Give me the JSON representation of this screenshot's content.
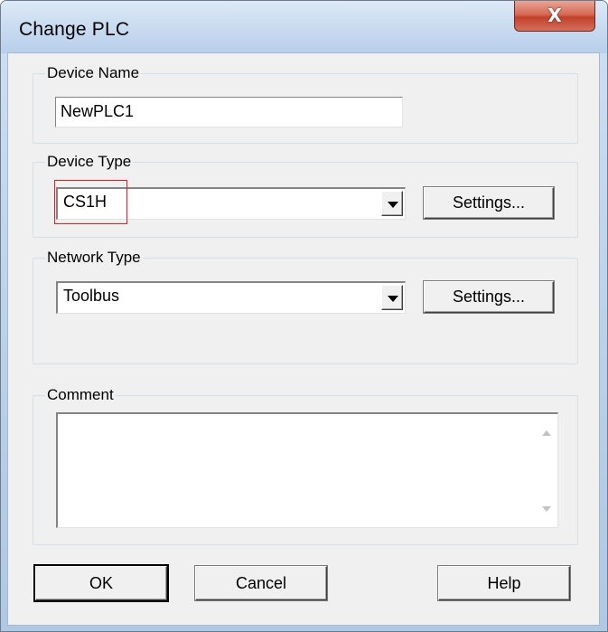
{
  "window": {
    "title": "Change PLC",
    "close_glyph": "X"
  },
  "device_name": {
    "group_label": "Device Name",
    "value": "NewPLC1"
  },
  "device_type": {
    "group_label": "Device Type",
    "selected": "CS1H",
    "settings_label": "Settings..."
  },
  "network_type": {
    "group_label": "Network Type",
    "selected": "Toolbus",
    "settings_label": "Settings..."
  },
  "comment": {
    "group_label": "Comment",
    "value": ""
  },
  "footer": {
    "ok_label": "OK",
    "cancel_label": "Cancel",
    "help_label": "Help"
  },
  "icons": {
    "close": "close-icon",
    "dropdown": "chevron-down-icon",
    "scroll_up": "scroll-up-arrow-icon",
    "scroll_down": "scroll-down-arrow-icon"
  },
  "colors": {
    "highlight": "#e02020",
    "close_button": "#c2412b"
  }
}
